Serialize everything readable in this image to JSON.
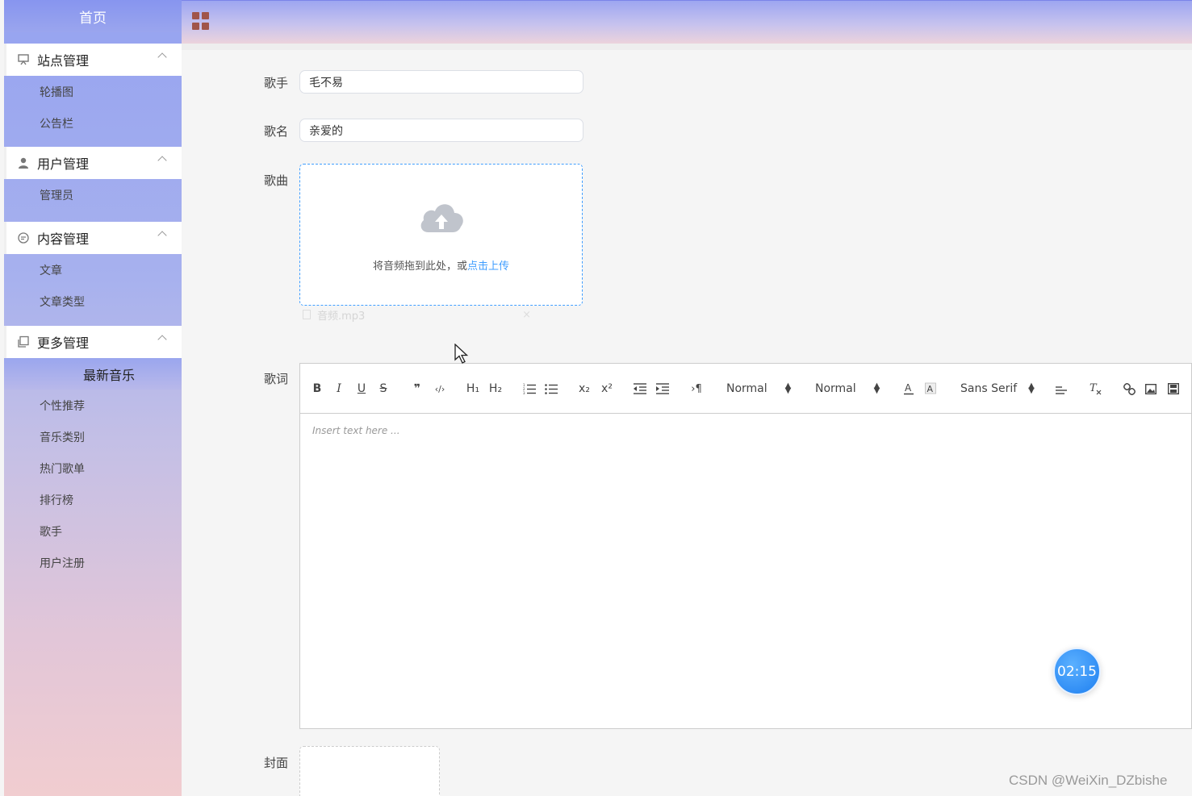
{
  "sidebar": {
    "home_label": "首页",
    "groups": [
      {
        "title": "站点管理",
        "icon": "monitor-icon",
        "items": [
          "轮播图",
          "公告栏"
        ]
      },
      {
        "title": "用户管理",
        "icon": "user-icon",
        "items": [
          "管理员"
        ]
      },
      {
        "title": "内容管理",
        "icon": "chat-icon",
        "items": [
          "文章",
          "文章类型"
        ]
      },
      {
        "title": "更多管理",
        "icon": "copy-icon",
        "items": [
          "最新音乐",
          "个性推荐",
          "音乐类别",
          "热门歌单",
          "排行榜",
          "歌手",
          "用户注册"
        ]
      }
    ]
  },
  "header": {
    "menu_icon": "grid-icon",
    "icon_color": "#a0554a"
  },
  "form": {
    "singer_label": "歌手",
    "singer_value": "毛不易",
    "song_name_label": "歌名",
    "song_name_value": "亲爱的",
    "song_label": "歌曲",
    "upload_text": "将音频拖到此处，或",
    "upload_link": "点击上传",
    "uploaded_file": "音频.mp3",
    "lyrics_label": "歌词",
    "cover_label": "封面"
  },
  "editor": {
    "tools": [
      "B",
      "I",
      "U",
      "S",
      "❞",
      "‹/›",
      "H₁",
      "H₂",
      "ol",
      "ul",
      "x₂",
      "x²",
      "outdent",
      "indent",
      "›¶"
    ],
    "size_select": "Normal",
    "header_select": "Normal",
    "font_select": "Sans Serif",
    "placeholder": "Insert text here ..."
  },
  "timer": "02:15",
  "watermark": "CSDN @WeiXin_DZbishe",
  "colors": {
    "accent": "#409eff",
    "sidebar_top": "#96a3f0",
    "sidebar_bottom": "#f1cdd0"
  }
}
